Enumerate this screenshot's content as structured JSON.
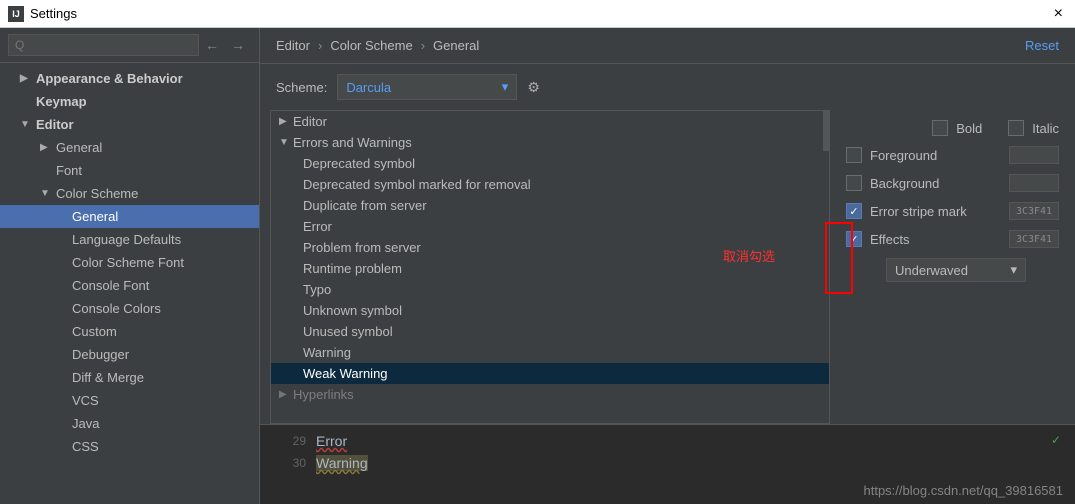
{
  "titlebar": {
    "title": "Settings",
    "close": "×"
  },
  "search": {
    "placeholder": "Q"
  },
  "nav": {
    "appearance": "Appearance & Behavior",
    "keymap": "Keymap",
    "editor": "Editor",
    "general": "General",
    "font": "Font",
    "color_scheme": "Color Scheme",
    "cs_general": "General",
    "cs_lang_defaults": "Language Defaults",
    "cs_font": "Color Scheme Font",
    "cs_console_font": "Console Font",
    "cs_console_colors": "Console Colors",
    "cs_custom": "Custom",
    "cs_debugger": "Debugger",
    "cs_diff": "Diff & Merge",
    "cs_vcs": "VCS",
    "cs_java": "Java",
    "cs_css": "CSS"
  },
  "breadcrumb": {
    "p1": "Editor",
    "p2": "Color Scheme",
    "p3": "General",
    "reset": "Reset"
  },
  "scheme": {
    "label": "Scheme:",
    "value": "Darcula"
  },
  "categories": {
    "editor": "Editor",
    "errors_warnings": "Errors and Warnings",
    "items": [
      "Deprecated symbol",
      "Deprecated symbol marked for removal",
      "Duplicate from server",
      "Error",
      "Problem from server",
      "Runtime problem",
      "Typo",
      "Unknown symbol",
      "Unused symbol",
      "Warning",
      "Weak Warning"
    ],
    "hyperlinks": "Hyperlinks"
  },
  "options": {
    "bold": "Bold",
    "italic": "Italic",
    "foreground": "Foreground",
    "background": "Background",
    "error_stripe": "Error stripe mark",
    "effects": "Effects",
    "effects_type": "Underwaved",
    "swatch1": "3C3F41",
    "swatch2": "3C3F41"
  },
  "annotation": "取消勾选",
  "preview": {
    "line29": "29",
    "line30": "30",
    "error": "Error",
    "warning": "Warning"
  },
  "watermark": "https://blog.csdn.net/qq_39816581"
}
